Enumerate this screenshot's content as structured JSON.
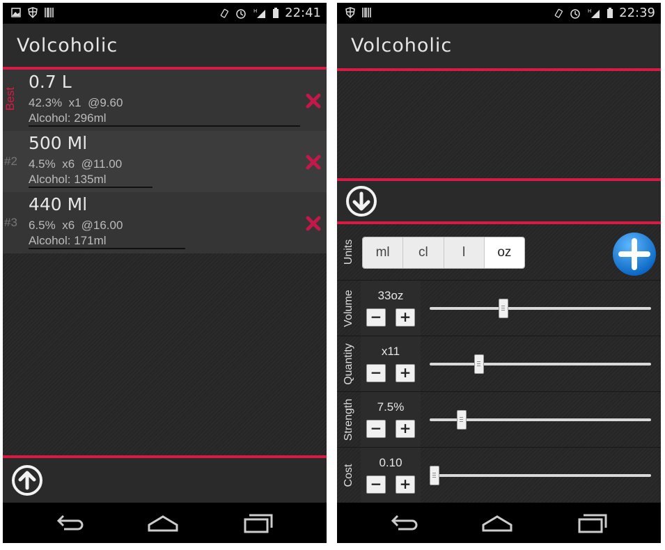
{
  "left": {
    "status_time": "22:41",
    "app_title": "Volcoholic",
    "items": [
      {
        "rank": "Best",
        "name": "0.7 L",
        "strength": "42.3%",
        "qty": "x1",
        "price": "@9.60",
        "alcohol": "Alcohol: 296ml",
        "alcohol_fraction": 1.0
      },
      {
        "rank": "#2",
        "name": "500 Ml",
        "strength": "4.5%",
        "qty": "x6",
        "price": "@11.00",
        "alcohol": "Alcohol: 135ml",
        "alcohol_fraction": 0.456
      },
      {
        "rank": "#3",
        "name": "440 Ml",
        "strength": "6.5%",
        "qty": "x6",
        "price": "@16.00",
        "alcohol": "Alcohol: 171ml",
        "alcohol_fraction": 0.578
      }
    ]
  },
  "right": {
    "status_time": "22:39",
    "app_title": "Volcoholic",
    "units": {
      "label": "Units",
      "options": [
        "ml",
        "cl",
        "l",
        "oz"
      ],
      "selected": "oz"
    },
    "controls": [
      {
        "label": "Volume",
        "value": "33oz",
        "fraction": 0.33
      },
      {
        "label": "Quantity",
        "value": "x11",
        "fraction": 0.22
      },
      {
        "label": "Strength",
        "value": "7.5%",
        "fraction": 0.14
      },
      {
        "label": "Cost",
        "value": "0.10",
        "fraction": 0.0
      }
    ],
    "minus_label": "−",
    "plus_label": "+"
  },
  "colors": {
    "accent": "#d81b45",
    "add_button": "#1e88e5"
  }
}
